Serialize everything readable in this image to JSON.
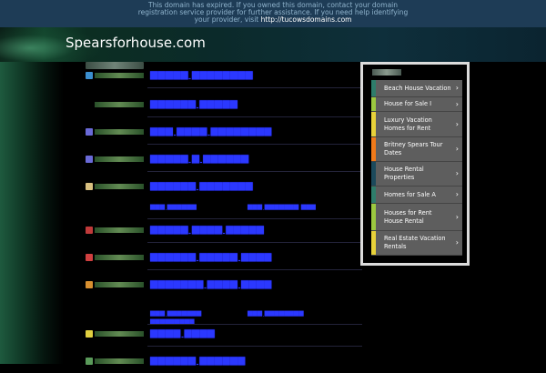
{
  "banner": {
    "line1": "This domain has expired. If you owned this domain, contact your domain",
    "line2": "registration service provider for further assistance. If you need help",
    "line3": "identifying your provider, visit",
    "link": "http://tucowsdomains.com"
  },
  "header": {
    "site_title": "Spearsforhouse.com"
  },
  "related": {
    "items": [
      {
        "label": "Beach House Vacation",
        "color": "#2e7d6b"
      },
      {
        "label": "House for Sale I",
        "color": "#9cc940"
      },
      {
        "label": "Luxury Vacation Homes for Rent",
        "color": "#e8d23a"
      },
      {
        "label": "Britney Spears Tour Dates",
        "color": "#f07a1a"
      },
      {
        "label": "House Rental Properties",
        "color": "#1c4a5c"
      },
      {
        "label": "Homes for Sale A",
        "color": "#2e7d6b"
      },
      {
        "label": "Houses for Rent House Rental",
        "color": "#9cc940"
      },
      {
        "label": "Real Estate Vacation Rentals",
        "color": "#e8d23a"
      }
    ]
  }
}
